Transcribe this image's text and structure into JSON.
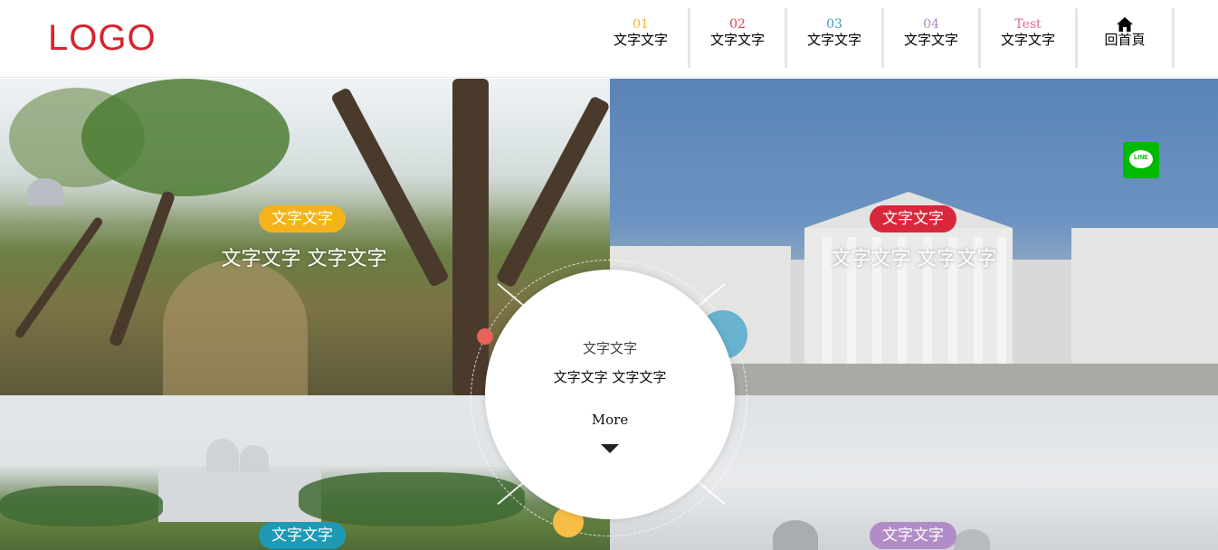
{
  "logo": "LOGO",
  "nav": [
    {
      "num": "01",
      "label": "文字文字",
      "color": "#f3b43a"
    },
    {
      "num": "02",
      "label": "文字文字",
      "color": "#e2434f"
    },
    {
      "num": "03",
      "label": "文字文字",
      "color": "#3b9dbf"
    },
    {
      "num": "04",
      "label": "文字文字",
      "color": "#ad8ac7"
    },
    {
      "num": "Test",
      "label": "文字文字",
      "color": "#e26a8d"
    },
    {
      "icon": "home-icon",
      "label": "回首頁",
      "color": "#000000"
    }
  ],
  "tiles": [
    {
      "badge": "文字文字",
      "badge_color": "#f4b31c",
      "title": "文字文字 文字文字"
    },
    {
      "badge": "文字文字",
      "badge_color": "#d9273b",
      "title": "文字文字 文字文字"
    },
    {
      "badge": "文字文字",
      "badge_color": "#1e9ab6"
    },
    {
      "badge": "文字文字",
      "badge_color": "#b28cc7"
    }
  ],
  "center": {
    "subtitle": "文字文字",
    "title": "文字文字 文字文字",
    "more": "More"
  },
  "line_button": {
    "icon": "line-icon",
    "text": "LINE",
    "color": "#00b900"
  },
  "accent_dots": [
    "#e8625a",
    "#52a9cc",
    "#f7bd46"
  ]
}
